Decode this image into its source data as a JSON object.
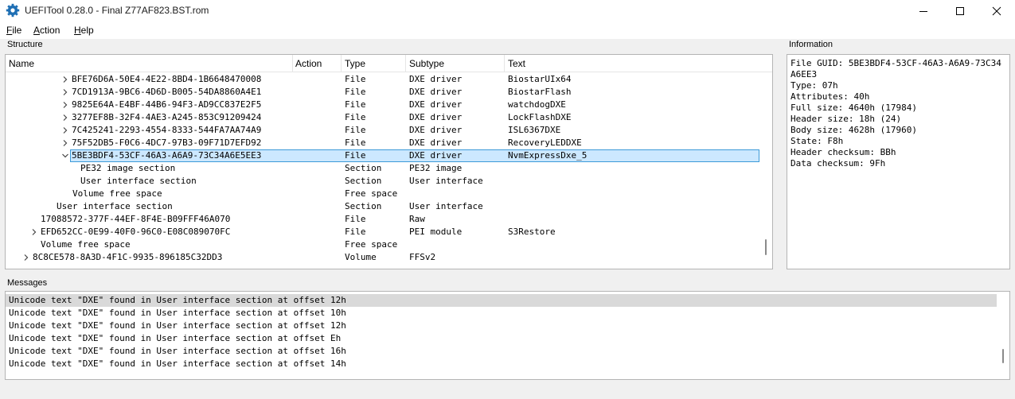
{
  "window": {
    "title": "UEFITool 0.28.0 - Final Z77AF823.BST.rom",
    "app_icon": "gear-icon"
  },
  "menu": {
    "items": [
      {
        "accel": "F",
        "rest": "ile"
      },
      {
        "accel": "A",
        "rest": "ction"
      },
      {
        "accel": "H",
        "rest": "elp"
      }
    ]
  },
  "structure": {
    "label": "Structure",
    "columns": [
      "Name",
      "Action",
      "Type",
      "Subtype",
      "Text"
    ],
    "rows": [
      {
        "expander": "collapsed",
        "name": "BFE76D6A-50E4-4E22-8BD4-1B6648470008",
        "action": "",
        "type": "File",
        "subtype": "DXE driver",
        "text": "BiostarUIx64"
      },
      {
        "expander": "collapsed",
        "name": "7CD1913A-9BC6-4D6D-B005-54DA8860A4E1",
        "action": "",
        "type": "File",
        "subtype": "DXE driver",
        "text": "BiostarFlash"
      },
      {
        "expander": "collapsed",
        "name": "9825E64A-E4BF-44B6-94F3-AD9CC837E2F5",
        "action": "",
        "type": "File",
        "subtype": "DXE driver",
        "text": "watchdogDXE"
      },
      {
        "expander": "collapsed",
        "name": "3277EF8B-32F4-4AE3-A245-853C91209424",
        "action": "",
        "type": "File",
        "subtype": "DXE driver",
        "text": "LockFlashDXE"
      },
      {
        "expander": "collapsed",
        "name": "7C425241-2293-4554-8333-544FA7AA74A9",
        "action": "",
        "type": "File",
        "subtype": "DXE driver",
        "text": "ISL6367DXE"
      },
      {
        "expander": "collapsed",
        "name": "75F52DB5-F0C6-4DC7-97B3-09F71D7EFD92",
        "action": "",
        "type": "File",
        "subtype": "DXE driver",
        "text": "RecoveryLEDDXE"
      },
      {
        "expander": "expanded",
        "name": "5BE3BDF4-53CF-46A3-A6A9-73C34A6E5EE3",
        "action": "",
        "type": "File",
        "subtype": "DXE driver",
        "text": "NvmExpressDxe_5",
        "selected": true
      },
      {
        "expander": "none",
        "name": "PE32 image section",
        "action": "",
        "type": "Section",
        "subtype": "PE32 image",
        "text": ""
      },
      {
        "expander": "none",
        "name": "User interface section",
        "action": "",
        "type": "Section",
        "subtype": "User interface",
        "text": ""
      },
      {
        "expander": "none",
        "name": "Volume free space",
        "action": "",
        "type": "Free space",
        "subtype": "",
        "text": ""
      },
      {
        "expander": "none",
        "name": "User interface section",
        "action": "",
        "type": "Section",
        "subtype": "User interface",
        "text": ""
      },
      {
        "expander": "none",
        "name": "17088572-377F-44EF-8F4E-B09FFF46A070",
        "action": "",
        "type": "File",
        "subtype": "Raw",
        "text": ""
      },
      {
        "expander": "collapsed",
        "name": "EFD652CC-0E99-40F0-96C0-E08C089070FC",
        "action": "",
        "type": "File",
        "subtype": "PEI module",
        "text": "S3Restore"
      },
      {
        "expander": "none",
        "name": "Volume free space",
        "action": "",
        "type": "Free space",
        "subtype": "",
        "text": ""
      },
      {
        "expander": "collapsed",
        "name": "8C8CE578-8A3D-4F1C-9935-896185C32DD3",
        "action": "",
        "type": "Volume",
        "subtype": "FFSv2",
        "text": ""
      }
    ]
  },
  "information": {
    "label": "Information",
    "text": "File GUID: 5BE3BDF4-53CF-46A3-A6A9-73C34A6EE3\nType: 07h\nAttributes: 40h\nFull size: 4640h (17984)\nHeader size: 18h (24)\nBody size: 4628h (17960)\nState: F8h\nHeader checksum: BBh\nData checksum: 9Fh"
  },
  "messages": {
    "label": "Messages",
    "items": [
      "Unicode text \"DXE\" found in User interface section at offset 12h",
      "Unicode text \"DXE\" found in User interface section at offset 10h",
      "Unicode text \"DXE\" found in User interface section at offset 12h",
      "Unicode text \"DXE\" found in User interface section at offset Eh",
      "Unicode text \"DXE\" found in User interface section at offset 16h",
      "Unicode text \"DXE\" found in User interface section at offset 14h"
    ]
  },
  "colors": {
    "selection_fill": "#cce8ff",
    "selection_border": "#3d9ad8",
    "message_selection": "#d9d9d9",
    "panel_border": "#b4b4b4"
  }
}
